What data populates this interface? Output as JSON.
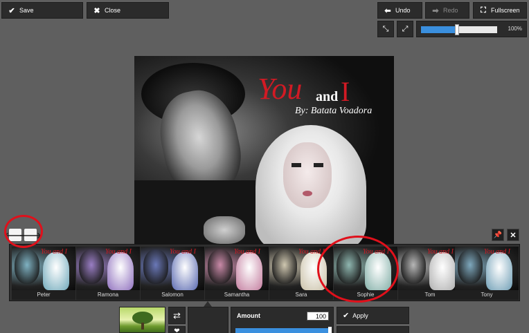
{
  "toolbar": {
    "save_label": "Save",
    "close_label": "Close",
    "undo_label": "Undo",
    "redo_label": "Redo",
    "fullscreen_label": "Fullscreen",
    "zoom_value": "100%",
    "zoom_level": 0.47
  },
  "canvas": {
    "title_you": "You",
    "title_and": "and",
    "title_i": "I",
    "byline": "By: Batata Voadora"
  },
  "filters": [
    {
      "name": "Peter",
      "tint": "#7fb2c2"
    },
    {
      "name": "Ramona",
      "tint": "#9a7ec4"
    },
    {
      "name": "Salomon",
      "tint": "#6a78b8"
    },
    {
      "name": "Samantha",
      "tint": "#c98aa8"
    },
    {
      "name": "Sara",
      "tint": "#cfc7b0"
    },
    {
      "name": "Sophie",
      "tint": "#8fb7b0"
    },
    {
      "name": "Tom",
      "tint": "#b7b7b7"
    },
    {
      "name": "Tony",
      "tint": "#7ea8bd"
    }
  ],
  "panel": {
    "amount_label": "Amount",
    "amount_value": "100",
    "apply_label": "Apply"
  },
  "colors": {
    "accent": "#3a8fde",
    "annotation": "#e0101b"
  }
}
